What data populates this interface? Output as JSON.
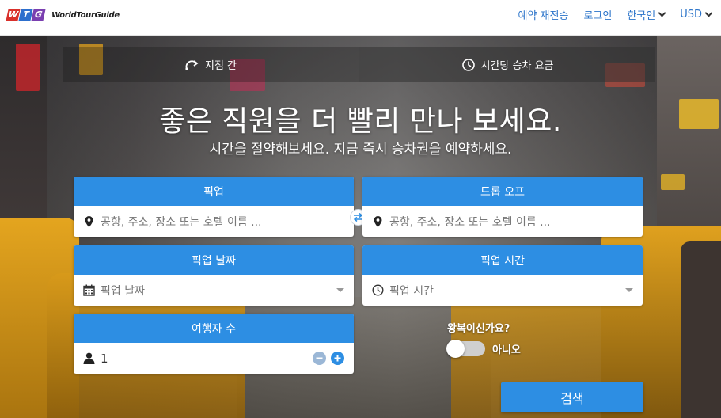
{
  "brand": {
    "logo_letters": [
      "W",
      "T",
      "G"
    ],
    "logo_name": "WorldTourGuide"
  },
  "nav": {
    "resend": "예약 재전송",
    "login": "로그인",
    "language": "한국인",
    "currency": "USD"
  },
  "tabs": [
    {
      "label": "지점 간",
      "icon": "route-arrow-icon"
    },
    {
      "label": "시간당 승차 요금",
      "icon": "clock-rate-icon"
    }
  ],
  "hero": {
    "headline": "좋은 직원을 더 빨리 만나 보세요.",
    "subline": "시간을 절약해보세요. 지금 즉시 승차권을 예약하세요."
  },
  "form": {
    "pickup": {
      "label": "픽업",
      "placeholder": "공항, 주소, 장소 또는 호텔 이름 ..."
    },
    "dropoff": {
      "label": "드롭 오프",
      "placeholder": "공항, 주소, 장소 또는 호텔 이름 ..."
    },
    "pickup_date": {
      "label": "픽업 날짜",
      "placeholder": "픽업 날짜"
    },
    "pickup_time": {
      "label": "픽업 시간",
      "placeholder": "픽업 시간"
    },
    "passengers": {
      "label": "여행자 수",
      "value": "1"
    },
    "round_trip": {
      "question": "왕복이신가요?",
      "state_label": "아니오",
      "enabled": false
    },
    "search_label": "검색"
  },
  "colors": {
    "primary": "#2d8ee3",
    "link": "#2a73c9",
    "logo_red": "#d9302b",
    "logo_blue": "#2d6fcd",
    "logo_purple": "#7a3fb0"
  }
}
